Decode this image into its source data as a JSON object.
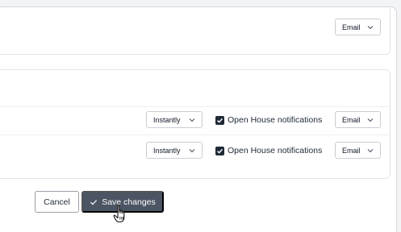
{
  "top_section": {
    "channel_select": {
      "value": "Email"
    }
  },
  "rows": [
    {
      "frequency": "Instantly",
      "notification_label": "Open House notifications",
      "checked": true,
      "channel": "Email"
    },
    {
      "frequency": "Instantly",
      "notification_label": "Open House notifications",
      "checked": true,
      "channel": "Email"
    }
  ],
  "footer": {
    "cancel_label": "Cancel",
    "save_label": "Save changes"
  },
  "icons": {
    "chevron": "chevron-down-icon",
    "check": "check-icon",
    "cursor": "hand-pointer-icon"
  },
  "colors": {
    "save_button_bg": "#4b5563",
    "checkbox_fill": "#1f2937"
  }
}
